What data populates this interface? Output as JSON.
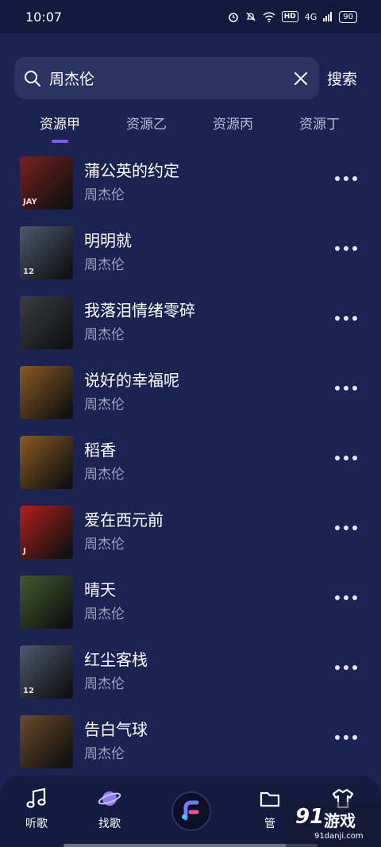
{
  "status_bar": {
    "time": "10:07",
    "network": "4G",
    "battery": "90",
    "hd": "HD"
  },
  "watermark": {
    "logo_num": "91",
    "logo_text": "游戏",
    "domain": "91danji.com"
  },
  "search": {
    "value": "周杰伦",
    "button": "搜索"
  },
  "tabs": [
    {
      "label": "资源甲"
    },
    {
      "label": "资源乙"
    },
    {
      "label": "资源丙"
    },
    {
      "label": "资源丁"
    }
  ],
  "active_tab": 0,
  "songs": [
    {
      "title": "蒲公英的约定",
      "artist": "周杰伦",
      "cover_color": "#7a1f1f",
      "cover_label": "JAY"
    },
    {
      "title": "明明就",
      "artist": "周杰伦",
      "cover_color": "#4a5a6e",
      "cover_label": "12"
    },
    {
      "title": "我落泪情绪零碎",
      "artist": "周杰伦",
      "cover_color": "#3a3e42",
      "cover_label": ""
    },
    {
      "title": "说好的幸福呢",
      "artist": "周杰伦",
      "cover_color": "#8a5a22",
      "cover_label": ""
    },
    {
      "title": "稻香",
      "artist": "周杰伦",
      "cover_color": "#8a5a22",
      "cover_label": ""
    },
    {
      "title": "爱在西元前",
      "artist": "周杰伦",
      "cover_color": "#b0201a",
      "cover_label": "J"
    },
    {
      "title": "晴天",
      "artist": "周杰伦",
      "cover_color": "#3f5a2e",
      "cover_label": ""
    },
    {
      "title": "红尘客栈",
      "artist": "周杰伦",
      "cover_color": "#4a5a6e",
      "cover_label": "12"
    },
    {
      "title": "告白气球",
      "artist": "周杰伦",
      "cover_color": "#6a4a2a",
      "cover_label": ""
    }
  ],
  "bottom_nav": [
    {
      "label": "听歌",
      "icon": "music-note-icon"
    },
    {
      "label": "找歌",
      "icon": "planet-icon"
    },
    {
      "label": "",
      "icon": "app-logo-icon"
    },
    {
      "label": "管",
      "icon": "folder-icon"
    },
    {
      "label": "",
      "icon": "shirt-icon"
    }
  ],
  "colors": {
    "background": "#1a2352",
    "accent": "#7c5cf5",
    "search_bg": "#2b3461"
  }
}
